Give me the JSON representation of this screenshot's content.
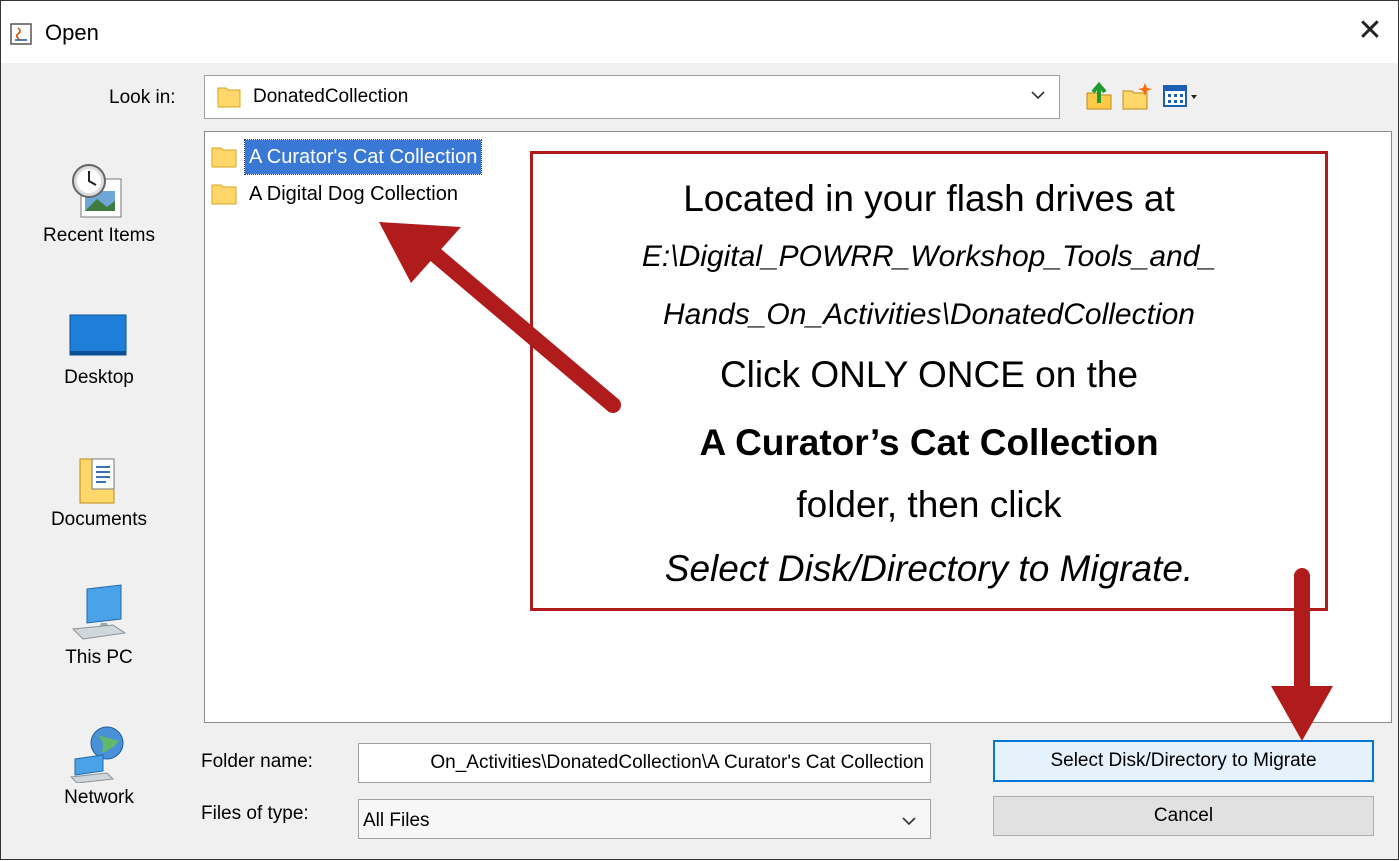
{
  "window": {
    "title": "Open",
    "close_glyph": "✕"
  },
  "toolbar": {
    "look_in_label": "Look in:",
    "look_in_value": "DonatedCollection"
  },
  "places": [
    {
      "label": "Recent Items",
      "icon": "recent-items-icon"
    },
    {
      "label": "Desktop",
      "icon": "desktop-icon"
    },
    {
      "label": "Documents",
      "icon": "documents-icon"
    },
    {
      "label": "This PC",
      "icon": "this-pc-icon"
    },
    {
      "label": "Network",
      "icon": "network-icon"
    }
  ],
  "files": [
    {
      "name": "A Curator's Cat Collection",
      "selected": true
    },
    {
      "name": "A Digital Dog Collection",
      "selected": false
    }
  ],
  "form": {
    "folder_name_label": "Folder name:",
    "folder_name_value": "On_Activities\\DonatedCollection\\A Curator's Cat Collection",
    "files_of_type_label": "Files of type:",
    "files_of_type_value": "All Files"
  },
  "buttons": {
    "primary": "Select Disk/Directory to Migrate",
    "cancel": "Cancel"
  },
  "callout": {
    "line1": "Located in your flash drives at",
    "line2": "E:\\Digital_POWRR_Workshop_Tools_and_",
    "line3": "Hands_On_Activities\\DonatedCollection",
    "line4": "Click ONLY ONCE on the",
    "line5": "A Curator’s Cat Collection",
    "line6": "folder, then click",
    "line7": "Select Disk/Directory to Migrate."
  },
  "colors": {
    "accent_red": "#b01c1c",
    "selection_blue": "#3a78d6",
    "primary_border": "#0078d7"
  }
}
